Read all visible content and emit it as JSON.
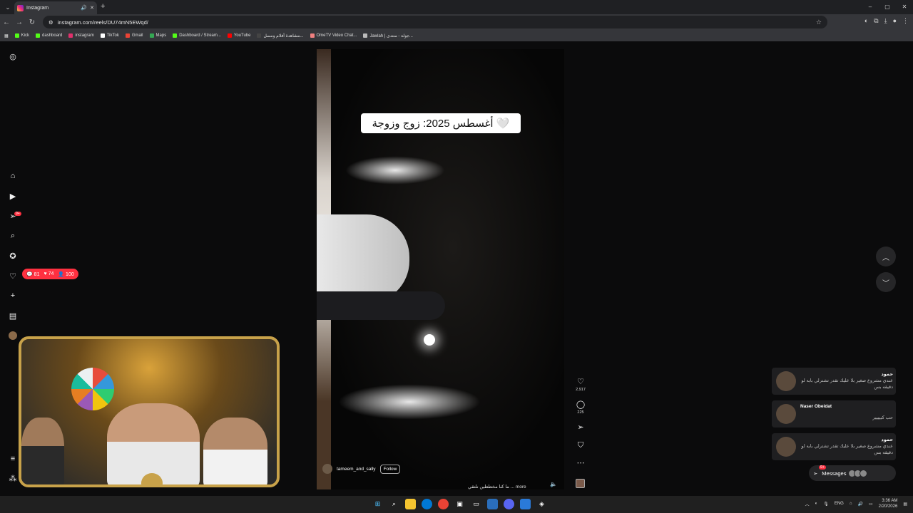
{
  "browser": {
    "tab_title": "Instagram",
    "url": "instagram.com/reels/DU74mN5EWqd/",
    "bookmarks": [
      "Kick",
      "dashboard",
      "instagram",
      "TikTok",
      "Gmail",
      "Maps",
      "Dashboard / Stream...",
      "YouTube",
      "مشاهدة أفلام ومسل...",
      "OmeTV Video Chat...",
      "Jawlah | جولة - منتدى..."
    ]
  },
  "sidebar": {
    "notif_badge": "9+",
    "pill": {
      "comments": "81",
      "likes": "74",
      "follows": "100"
    }
  },
  "reel": {
    "overlay_caption": "أغسطس 2025: زوج وزوجة 🤍",
    "username": "tameem_and_sally",
    "follow_label": "Follow",
    "caption": "ما كنا مخططين نلتقي ... more",
    "likes": "2,917",
    "comments": "225"
  },
  "messages": [
    {
      "name": "حمود",
      "text": "عندي مشروع صغير بلا عليك تقدر تشترلي بابه لو دقيقه بس"
    },
    {
      "name": "Naser Obeidat",
      "text": "حب كبيييير"
    },
    {
      "name": "حمود",
      "text": "عندي مشروع صغير بلا عليك تقدر تشترلي بابه لو دقيقه بس"
    }
  ],
  "messages_button": {
    "label": "Messages",
    "badge": "9+"
  },
  "taskbar": {
    "lang": "ENG",
    "time": "3:36 AM",
    "date": "2/20/2026"
  },
  "colors": {
    "accent_red": "#ff3040",
    "frame_gold": "#c8a24a"
  }
}
